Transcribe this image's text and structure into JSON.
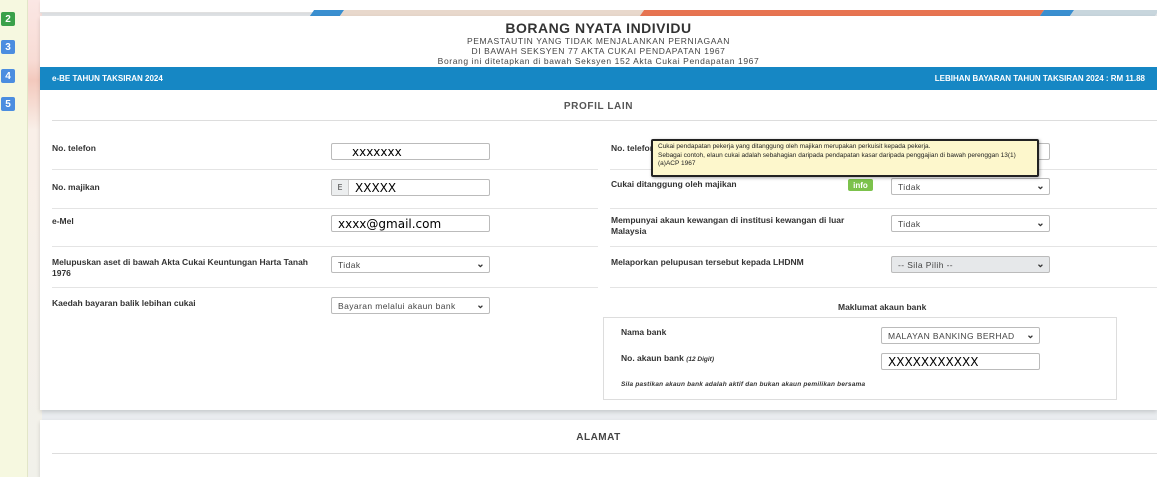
{
  "steps": [
    "2",
    "3",
    "4",
    "5"
  ],
  "form": {
    "title": "BORANG NYATA INDIVIDU",
    "subtitle_1": "PEMASTAUTIN YANG TIDAK MENJALANKAN PERNIAGAAN",
    "subtitle_2": "DI BAWAH SEKSYEN 77 AKTA CUKAI PENDAPATAN 1967",
    "subtitle_3": "Borang ini ditetapkan di bawah Seksyen 152 Akta Cukai Pendapatan 1967"
  },
  "bar": {
    "left": "e-BE TAHUN TAKSIRAN 2024",
    "right": "LEBIHAN BAYARAN TAHUN TAKSIRAN 2024 : RM 11.88"
  },
  "section": {
    "title": "PROFIL LAIN"
  },
  "fields": {
    "phone_label": "No. telefon",
    "phone_value": "xxxxxxx",
    "phone2_label": "No. telefon",
    "employer_label": "No. majikan",
    "employer_prefix": "E",
    "employer_value": "XXXXX",
    "email_label": "e-Mel",
    "email_value": "xxxx@gmail.com",
    "asset_label": "Melupuskan aset di bawah Akta Cukai Keuntungan Harta Tanah 1976",
    "asset_value": "Tidak",
    "refund_label": "Kaedah bayaran balik lebihan cukai",
    "refund_value": "Bayaran melalui akaun bank",
    "tax_borne_label": "Cukai ditanggung oleh majikan",
    "tax_borne_value": "Tidak",
    "foreign_acc_label": "Mempunyai akaun kewangan di institusi kewangan di luar Malaysia",
    "foreign_acc_value": "Tidak",
    "report_label": "Melaporkan pelupusan tersebut kepada LHDNM",
    "report_value": "-- Sila Pilih --"
  },
  "info_badge": "info",
  "tooltip": {
    "line1": "Cukai pendapatan pekerja yang ditanggung oleh majikan merupakan perkuisit kepada pekerja.",
    "line2": "Sebagai contoh, elaun cukai adalah sebahagian daripada pendapatan kasar daripada penggajian di bawah perenggan 13(1)(a)ACP 1967"
  },
  "bank": {
    "title": "Maklumat akaun bank",
    "name_label": "Nama bank",
    "name_value": "MALAYAN BANKING BERHAD",
    "acc_label": "No. akaun bank",
    "acc_hint": "(12 Digit)",
    "acc_value": "XXXXXXXXXXX",
    "note": "Sila pastikan akaun bank adalah aktif dan bukan akaun pemilikan bersama"
  },
  "address": {
    "title": "ALAMAT"
  },
  "colors": {
    "bar": "#1687c4",
    "info": "#7cc24c",
    "tooltip_bg": "#fdf7cc"
  }
}
